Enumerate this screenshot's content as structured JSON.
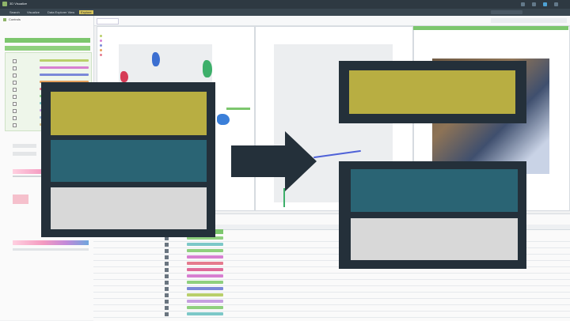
{
  "window": {
    "title": "3D Visualize"
  },
  "menu": {
    "items": [
      "Search",
      "Visualize",
      "Data Explorer View",
      "Explore"
    ],
    "active_index": 3
  },
  "sidebar": {
    "title": "Controls"
  },
  "table": {
    "rows": 15,
    "columns": 6
  },
  "overlay": {
    "description_icon": "layout-transfer-icon",
    "colors": {
      "frame": "#24303a",
      "olive": "#b8ae42",
      "teal": "#2a6474",
      "grey": "#d8d8d8"
    }
  }
}
